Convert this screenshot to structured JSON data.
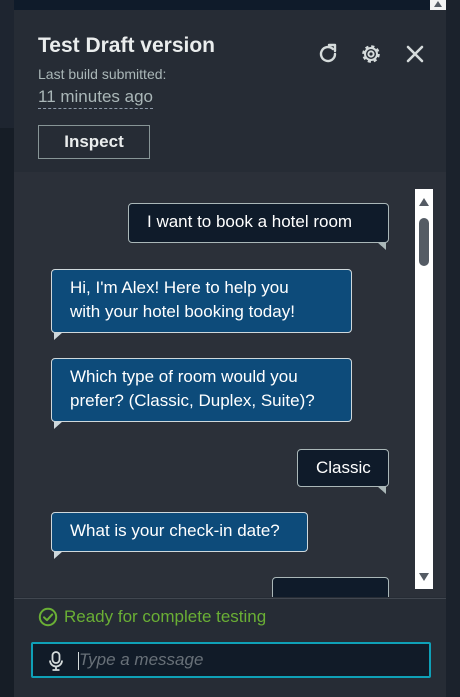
{
  "panel": {
    "title": "Test Draft version",
    "subtitle": "Last build submitted:",
    "build_time": "11 minutes ago",
    "inspect_label": "Inspect"
  },
  "header_icons": [
    "refresh-icon",
    "settings-gear-icon",
    "close-icon"
  ],
  "conversation": {
    "messages": [
      {
        "from": "user",
        "text": "I want to book a hotel room"
      },
      {
        "from": "bot",
        "lines": [
          "Hi, I'm Alex! Here to help you",
          "with your hotel booking today!"
        ]
      },
      {
        "from": "bot",
        "lines": [
          "Which type of room would you",
          "prefer? (Classic, Duplex, Suite)?"
        ]
      },
      {
        "from": "user",
        "text": "Classic"
      },
      {
        "from": "bot",
        "text": "What is your check-in date?"
      },
      {
        "from": "user",
        "text": ""
      }
    ]
  },
  "status": {
    "text": "Ready for complete testing",
    "color": "#6aaf35"
  },
  "composer": {
    "placeholder": "Type a message",
    "value": ""
  },
  "colors": {
    "panel_bg": "#262c35",
    "chat_bg": "#2b3039",
    "bot_bubble": "#0d4b7a",
    "user_bubble": "#0f1b2a",
    "input_focus": "#0fa0b7"
  }
}
